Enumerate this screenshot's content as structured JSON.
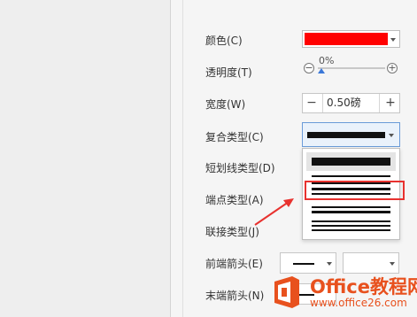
{
  "form": {
    "color_label": "颜色(C)",
    "color_value": "#ff0000",
    "transparency_label": "透明度(T)",
    "transparency_value": "0%",
    "width_label": "宽度(W)",
    "width_value": "0.50磅",
    "width_minus": "−",
    "width_plus": "+",
    "compound_label": "复合类型(C)",
    "dash_label": "短划线类型(D)",
    "cap_label": "端点类型(A)",
    "join_label": "联接类型(J)",
    "start_arrow_label": "前端箭头(E)",
    "end_arrow_label": "末端箭头(N)"
  },
  "compound_options": [
    {
      "name": "single"
    },
    {
      "name": "double"
    },
    {
      "name": "thick-thin"
    },
    {
      "name": "thin-thick"
    },
    {
      "name": "triple"
    }
  ],
  "watermark": {
    "title": "Office教程网",
    "url": "www.office26.com"
  },
  "colors": {
    "accent_red": "#e8322f",
    "brand_orange": "#e8511e",
    "focus_blue": "#6a9bd8"
  }
}
